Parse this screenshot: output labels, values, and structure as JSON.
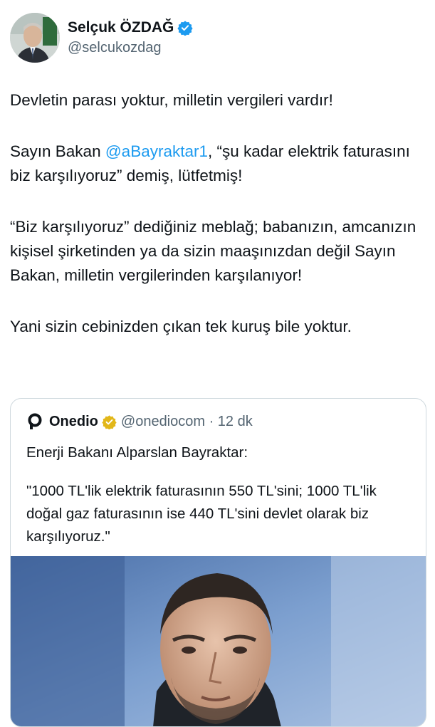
{
  "author": {
    "display_name": "Selçuk ÖZDAĞ",
    "handle": "@selcukozdag",
    "verified_icon": "verified-badge-icon",
    "avatar": "avatar"
  },
  "tweet": {
    "p1": "Devletin parası yoktur, milletin vergileri vardır!",
    "p2_before": "Sayın Bakan ",
    "p2_mention": "@aBayraktar1",
    "p2_after": ", “şu kadar elektrik faturasını biz karşılıyoruz” demiş, lütfetmiş!",
    "p3": "“Biz karşılıyoruz” dediğiniz meblağ; babanızın, amcanızın kişisel şirketinden ya da sizin maaşınızdan değil Sayın Bakan, milletin vergilerinden karşılanıyor!",
    "p4": "Yani sizin cebinizden çıkan tek kuruş bile yoktur."
  },
  "quote": {
    "name": "Onedio",
    "handle_time": "@onediocom · 12 dk",
    "logo_icon": "onedio-logo-icon",
    "badge_icon": "gold-verified-badge-icon",
    "line1": "Enerji Bakanı Alparslan Bayraktar:",
    "line2": "\"1000 TL'lik elektrik faturasının 550 TL'sini; 1000 TL'lik doğal gaz faturasının ise 440 TL'sini devlet olarak biz karşılıyoruz.\"",
    "photo": "minister-photo"
  },
  "colors": {
    "link": "#1d9bf0",
    "verified": "#1d9bf0",
    "gold_badge": "#e2b719",
    "secondary_text": "#536471",
    "border": "#cfd9de"
  }
}
